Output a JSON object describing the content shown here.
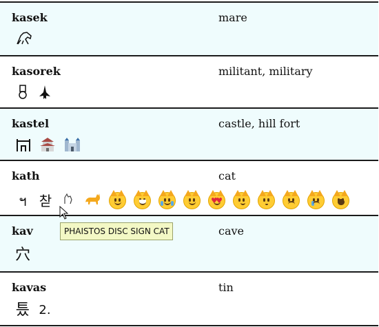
{
  "entries": [
    {
      "word": "kasek",
      "gloss": "mare",
      "glyphs": [
        "🐴"
      ]
    },
    {
      "word": "kasorek",
      "gloss": "militant, military",
      "glyphs": [
        "🎖",
        "✈"
      ]
    },
    {
      "word": "kastel",
      "gloss": "castle, hill fort",
      "glyphs": [
        "ⓘ",
        "🏯",
        "🏰"
      ]
    },
    {
      "word": "kath",
      "gloss": "cat",
      "glyphs": [
        "๩",
        "찫",
        "𐇸",
        "🐈",
        "🐱",
        "😸",
        "😹",
        "😺",
        "😻",
        "😼",
        "😽",
        "😾",
        "😿",
        "🙀"
      ]
    },
    {
      "word": "kav",
      "gloss": "cave",
      "glyphs": [
        "穴"
      ]
    },
    {
      "word": "kavas",
      "gloss": "tin",
      "glyphs": [
        "틌",
        "↔"
      ]
    }
  ],
  "tooltip": "PHAISTOS DISC SIGN CAT",
  "colors": {
    "row_alt": "#effcfd",
    "rule": "#1a1a1a",
    "tooltip_bg": "#f3f8c5"
  }
}
